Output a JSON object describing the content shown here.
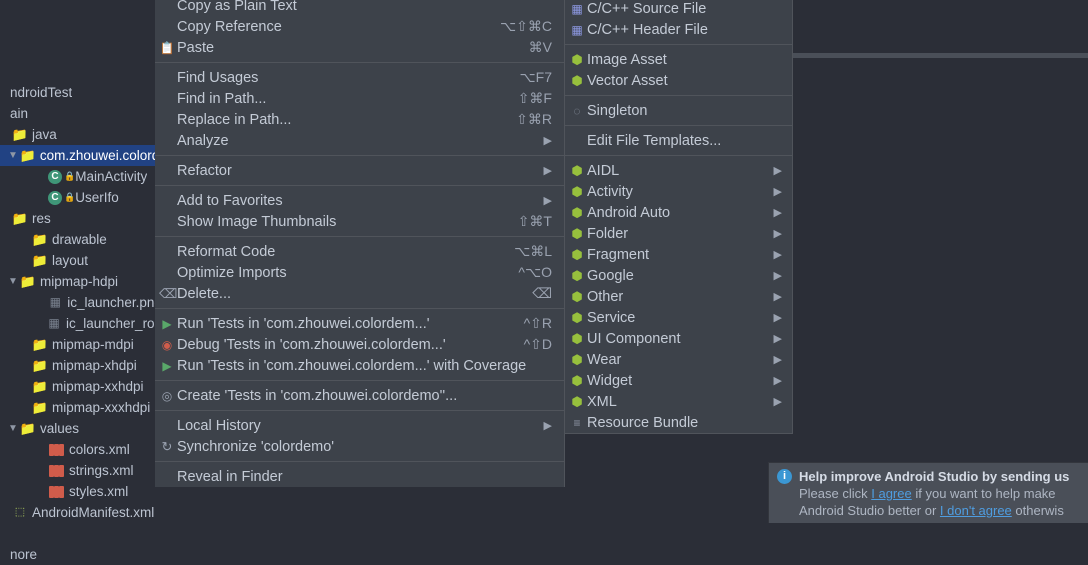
{
  "tree": {
    "rows": [
      {
        "pad": 0,
        "chev": "",
        "icon": "",
        "label": ""
      },
      {
        "pad": 0,
        "chev": "",
        "icon": "",
        "label": ""
      },
      {
        "pad": 0,
        "chev": "",
        "icon": "",
        "label": ""
      },
      {
        "pad": 0,
        "chev": "",
        "icon": "",
        "label": ""
      },
      {
        "pad": 0,
        "chev": "",
        "icon": "",
        "label": "ndroidTest"
      },
      {
        "pad": 0,
        "chev": "",
        "icon": "",
        "label": "ain"
      },
      {
        "pad": 0,
        "chev": "",
        "icon": "folder",
        "label": "java"
      },
      {
        "pad": 1,
        "chev": "open",
        "icon": "pkg",
        "label": "com.zhouwei.colorde",
        "selected": true
      },
      {
        "pad": 3,
        "chev": "",
        "icon": "class",
        "label": "MainActivity",
        "lock": true
      },
      {
        "pad": 3,
        "chev": "",
        "icon": "class",
        "label": "UserIfo",
        "lock": true
      },
      {
        "pad": 0,
        "chev": "",
        "icon": "folder",
        "label": "res",
        "res": true
      },
      {
        "pad": 2,
        "chev": "",
        "icon": "folder",
        "label": "drawable"
      },
      {
        "pad": 2,
        "chev": "",
        "icon": "folder",
        "label": "layout"
      },
      {
        "pad": 1,
        "chev": "open",
        "icon": "folder",
        "label": "mipmap-hdpi"
      },
      {
        "pad": 3,
        "chev": "",
        "icon": "png",
        "label": "ic_launcher.png"
      },
      {
        "pad": 3,
        "chev": "",
        "icon": "png",
        "label": "ic_launcher_round"
      },
      {
        "pad": 2,
        "chev": "",
        "icon": "folder",
        "label": "mipmap-mdpi"
      },
      {
        "pad": 2,
        "chev": "",
        "icon": "folder",
        "label": "mipmap-xhdpi"
      },
      {
        "pad": 2,
        "chev": "",
        "icon": "folder",
        "label": "mipmap-xxhdpi"
      },
      {
        "pad": 2,
        "chev": "",
        "icon": "folder",
        "label": "mipmap-xxxhdpi"
      },
      {
        "pad": 1,
        "chev": "open",
        "icon": "folder",
        "label": "values"
      },
      {
        "pad": 3,
        "chev": "",
        "icon": "xml",
        "label": "colors.xml"
      },
      {
        "pad": 3,
        "chev": "",
        "icon": "xml",
        "label": "strings.xml"
      },
      {
        "pad": 3,
        "chev": "",
        "icon": "xml",
        "label": "styles.xml"
      },
      {
        "pad": 0,
        "chev": "",
        "icon": "manifest",
        "label": "AndroidManifest.xml"
      },
      {
        "pad": 0,
        "chev": "",
        "icon": "",
        "label": ""
      },
      {
        "pad": 0,
        "chev": "",
        "icon": "",
        "label": "nore"
      }
    ]
  },
  "ctx": {
    "groups": [
      [
        {
          "label": "Copy as Plain Text",
          "short": ""
        },
        {
          "label": "Copy Reference",
          "short": "⌥⇧⌘C"
        },
        {
          "label": "Paste",
          "short": "⌘V",
          "icon": "paste"
        }
      ],
      [
        {
          "label": "Find Usages",
          "short": "⌥F7"
        },
        {
          "label": "Find in Path...",
          "short": "⇧⌘F"
        },
        {
          "label": "Replace in Path...",
          "short": "⇧⌘R"
        },
        {
          "label": "Analyze",
          "short": "",
          "sub": true
        }
      ],
      [
        {
          "label": "Refactor",
          "short": "",
          "sub": true
        }
      ],
      [
        {
          "label": "Add to Favorites",
          "short": "",
          "sub": true
        },
        {
          "label": "Show Image Thumbnails",
          "short": "⇧⌘T"
        }
      ],
      [
        {
          "label": "Reformat Code",
          "short": "⌥⌘L"
        },
        {
          "label": "Optimize Imports",
          "short": "^⌥O"
        },
        {
          "label": "Delete...",
          "short": "",
          "icon": "del",
          "shorticon": "⌫"
        }
      ],
      [
        {
          "label": "Run 'Tests in 'com.zhouwei.colordem...'",
          "short": "^⇧R",
          "icon": "run"
        },
        {
          "label": "Debug 'Tests in 'com.zhouwei.colordem...'",
          "short": "^⇧D",
          "icon": "debug"
        },
        {
          "label": "Run 'Tests in 'com.zhouwei.colordem...' with Coverage",
          "short": "",
          "icon": "cov"
        }
      ],
      [
        {
          "label": "Create 'Tests in 'com.zhouwei.colordemo''...",
          "short": "",
          "icon": "target"
        }
      ],
      [
        {
          "label": "Local History",
          "short": "",
          "sub": true
        },
        {
          "label": "Synchronize 'colordemo'",
          "short": "",
          "icon": "sync"
        }
      ],
      [
        {
          "label": "Reveal in Finder",
          "short": ""
        }
      ]
    ]
  },
  "sub": {
    "groups": [
      [
        {
          "label": "C/C++ Source File",
          "icon": "cpp"
        },
        {
          "label": "C/C++ Header File",
          "icon": "cpp"
        }
      ],
      [
        {
          "label": "Image Asset",
          "icon": "and"
        },
        {
          "label": "Vector Asset",
          "icon": "and"
        }
      ],
      [
        {
          "label": "Singleton",
          "icon": "single"
        }
      ],
      [
        {
          "label": "Edit File Templates..."
        }
      ],
      [
        {
          "label": "AIDL",
          "icon": "and",
          "sub": true
        },
        {
          "label": "Activity",
          "icon": "and",
          "sub": true
        },
        {
          "label": "Android Auto",
          "icon": "and",
          "sub": true
        },
        {
          "label": "Folder",
          "icon": "and",
          "sub": true
        },
        {
          "label": "Fragment",
          "icon": "and",
          "sub": true
        },
        {
          "label": "Google",
          "icon": "and",
          "sub": true
        },
        {
          "label": "Other",
          "icon": "and",
          "sub": true
        },
        {
          "label": "Service",
          "icon": "and",
          "sub": true
        },
        {
          "label": "UI Component",
          "icon": "and",
          "sub": true
        },
        {
          "label": "Wear",
          "icon": "and",
          "sub": true
        },
        {
          "label": "Widget",
          "icon": "and",
          "sub": true
        },
        {
          "label": "XML",
          "icon": "and",
          "sub": true
        },
        {
          "label": "Resource Bundle",
          "icon": "bundle"
        }
      ]
    ]
  },
  "notif": {
    "title": "Help improve Android Studio by sending us",
    "prefix": "Please click ",
    "agree": "I agree",
    "middle": " if you want to help make",
    "line2a": "Android Studio better or ",
    "dont": "I don't agree",
    "line2b": " otherwis"
  }
}
